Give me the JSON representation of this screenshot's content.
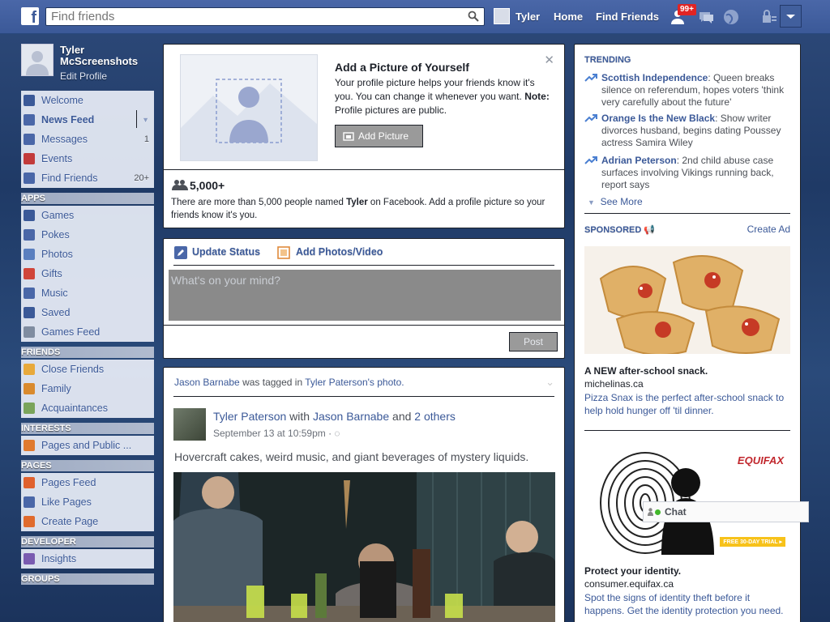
{
  "topbar": {
    "search_placeholder": "Find friends",
    "user_name": "Tyler",
    "home_label": "Home",
    "find_friends_label": "Find Friends",
    "friend_requests_badge": "99+",
    "brand_color": "#3b5998"
  },
  "sidebar": {
    "profile_name": "Tyler McScreenshots",
    "edit_profile": "Edit Profile",
    "main_items": [
      {
        "label": "Welcome",
        "icon": "facebook-icon",
        "count": ""
      },
      {
        "label": "News Feed",
        "icon": "news-feed-icon",
        "count": ""
      },
      {
        "label": "Messages",
        "icon": "messages-icon",
        "count": "1"
      },
      {
        "label": "Events",
        "icon": "calendar-icon",
        "count": ""
      },
      {
        "label": "Find Friends",
        "icon": "find-friends-icon",
        "count": "20+"
      }
    ],
    "apps_head": "APPS",
    "apps": [
      {
        "label": "Games",
        "icon": "games-icon"
      },
      {
        "label": "Pokes",
        "icon": "pokes-icon"
      },
      {
        "label": "Photos",
        "icon": "photos-icon"
      },
      {
        "label": "Gifts",
        "icon": "gifts-icon"
      },
      {
        "label": "Music",
        "icon": "music-icon"
      },
      {
        "label": "Saved",
        "icon": "saved-icon"
      },
      {
        "label": "Games Feed",
        "icon": "games-feed-icon"
      }
    ],
    "friends_head": "FRIENDS",
    "friends": [
      {
        "label": "Close Friends",
        "icon": "star-icon"
      },
      {
        "label": "Family",
        "icon": "family-icon"
      },
      {
        "label": "Acquaintances",
        "icon": "acquaintances-icon"
      }
    ],
    "interests_head": "INTERESTS",
    "interests": [
      {
        "label": "Pages and Public ...",
        "icon": "rss-icon"
      }
    ],
    "pages_head": "PAGES",
    "pages": [
      {
        "label": "Pages Feed",
        "icon": "megaphone-icon"
      },
      {
        "label": "Like Pages",
        "icon": "thumbs-up-icon"
      },
      {
        "label": "Create Page",
        "icon": "plus-icon"
      }
    ],
    "developer_head": "DEVELOPER",
    "developer": [
      {
        "label": "Insights",
        "icon": "chart-icon"
      }
    ],
    "groups_head": "GROUPS"
  },
  "profile_prompt": {
    "title": "Add a Picture of Yourself",
    "text": "Your profile picture helps your friends know it's you. You can change it whenever you want.",
    "note_label": "Note:",
    "note_text": " Profile pictures are public.",
    "button": "Add Picture",
    "count": "5,000+",
    "info_pre": "There are more than 5,000 people named ",
    "info_name": "Tyler",
    "info_post": " on Facebook. Add a profile picture so your friends know it's you."
  },
  "composer": {
    "update_status": "Update Status",
    "add_photos": "Add Photos/Video",
    "placeholder": "What's on your mind?",
    "post_button": "Post"
  },
  "feed_story": {
    "tagger": "Jason Barnabe",
    "tag_middle": " was tagged in ",
    "owner_photo": "Tyler Paterson's photo.",
    "author": "Tyler Paterson",
    "with_word": " with ",
    "with_name": "Jason Barnabe",
    "and_word": " and ",
    "others": "2 others",
    "timestamp": "September 13 at 10:59pm · ",
    "text": "Hovercraft cakes, weird music, and giant beverages of mystery liquids."
  },
  "right": {
    "trending_head": "TRENDING",
    "trends": [
      {
        "topic": "Scottish Independence",
        "desc": ": Queen breaks silence on referendum, hopes voters 'think very carefully about the future'"
      },
      {
        "topic": "Orange Is the New Black",
        "desc": ": Show writer divorces husband, begins dating Poussey actress Samira Wiley"
      },
      {
        "topic": "Adrian Peterson",
        "desc": ": 2nd child abuse case surfaces involving Vikings running back, report says"
      }
    ],
    "see_more": "See More",
    "sponsored_head": "SPONSORED",
    "create_ad": "Create Ad",
    "ads": [
      {
        "title": "A NEW after-school snack.",
        "domain": "michelinas.ca",
        "desc": "Pizza Snax is the perfect after-school snack to help hold hunger off 'til dinner."
      },
      {
        "title": "Protect your identity.",
        "domain": "consumer.equifax.ca",
        "desc": "Spot the signs of identity theft before it happens. Get the identity protection you need.",
        "brand": "EQUIFAX",
        "promo": "FREE 30-DAY TRIAL ▸"
      }
    ]
  },
  "chat": {
    "label": "Chat"
  }
}
